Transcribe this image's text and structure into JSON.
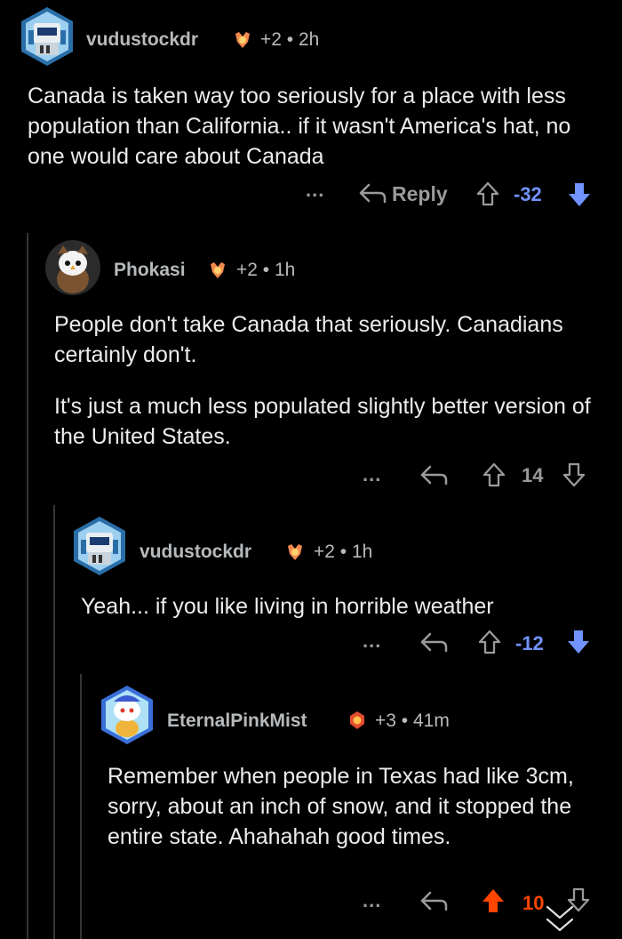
{
  "colors": {
    "background": "#000000",
    "text": "#ececec",
    "muted": "#9a9a9a",
    "downvote": "#7193ff",
    "upvote": "#ff4500",
    "thread_line": "#343536"
  },
  "comments": [
    {
      "username": "vudustockdr",
      "karma_badge": "+2",
      "time": "2h",
      "body": [
        "Canada is taken way too seriously for a place with less population than California.. if it wasn't America's hat, no one would care about Canada"
      ],
      "more_label": "...",
      "reply_label": "Reply",
      "score": "-32",
      "vote_state": "downvoted"
    },
    {
      "username": "Phokasi",
      "karma_badge": "+2",
      "time": "1h",
      "body": [
        "People don't take Canada that seriously. Canadians certainly don't.",
        "It's just a much less populated slightly better version of the United States."
      ],
      "more_label": "...",
      "score": "14",
      "vote_state": "none"
    },
    {
      "username": "vudustockdr",
      "karma_badge": "+2",
      "time": "1h",
      "body": [
        "Yeah... if you like living in horrible weather"
      ],
      "more_label": "...",
      "score": "-12",
      "vote_state": "downvoted"
    },
    {
      "username": "EternalPinkMist",
      "karma_badge": "+3",
      "time": "41m",
      "body": [
        "Remember when people in Texas had like 3cm, sorry, about an inch of snow, and it stopped the entire state. Ahahahah good times."
      ],
      "more_label": "...",
      "score": "10",
      "vote_state": "upvoted"
    }
  ],
  "separator": "•",
  "icons": [
    "robot-avatar-icon",
    "award-icon",
    "reply-arrow-icon",
    "upvote-arrow-icon",
    "downvote-arrow-icon",
    "scroll-down-chevron-icon"
  ]
}
